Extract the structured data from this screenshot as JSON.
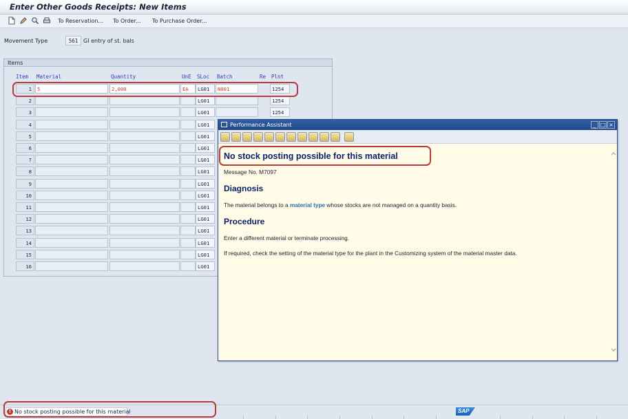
{
  "window": {
    "title": "Enter Other Goods Receipts: New Items"
  },
  "toolbar": {
    "icons": [
      "new-document-icon",
      "edit-pencil-icon",
      "find-icon",
      "print-icon"
    ],
    "buttons": [
      "To Reservation...",
      "To Order...",
      "To Purchase Order..."
    ]
  },
  "movement": {
    "label": "Movement Type",
    "code": "561",
    "text": "GI entry of st. bals"
  },
  "items": {
    "group_title": "Items",
    "headers": {
      "item": "Item",
      "material": "Material",
      "quantity": "Quantity",
      "une": "UnE",
      "sloc": "SLoc",
      "batch": "Batch",
      "re": "Re",
      "plnt": "Plnt"
    },
    "rows": [
      {
        "item": "1",
        "material": "5",
        "quantity": "2,000",
        "une": "EA",
        "sloc": "LG01",
        "batch": "N001",
        "plnt": "1254"
      },
      {
        "item": "2",
        "material": "",
        "quantity": "",
        "une": "",
        "sloc": "LG01",
        "batch": "",
        "plnt": "1254"
      },
      {
        "item": "3",
        "material": "",
        "quantity": "",
        "une": "",
        "sloc": "LG01",
        "batch": "",
        "plnt": "1254"
      },
      {
        "item": "4",
        "material": "",
        "quantity": "",
        "une": "",
        "sloc": "LG01",
        "batch": "",
        "plnt": ""
      },
      {
        "item": "5",
        "material": "",
        "quantity": "",
        "une": "",
        "sloc": "LG01",
        "batch": "",
        "plnt": ""
      },
      {
        "item": "6",
        "material": "",
        "quantity": "",
        "une": "",
        "sloc": "LG01",
        "batch": "",
        "plnt": ""
      },
      {
        "item": "7",
        "material": "",
        "quantity": "",
        "une": "",
        "sloc": "LG01",
        "batch": "",
        "plnt": ""
      },
      {
        "item": "8",
        "material": "",
        "quantity": "",
        "une": "",
        "sloc": "LG01",
        "batch": "",
        "plnt": ""
      },
      {
        "item": "9",
        "material": "",
        "quantity": "",
        "une": "",
        "sloc": "LG01",
        "batch": "",
        "plnt": ""
      },
      {
        "item": "10",
        "material": "",
        "quantity": "",
        "une": "",
        "sloc": "LG01",
        "batch": "",
        "plnt": ""
      },
      {
        "item": "11",
        "material": "",
        "quantity": "",
        "une": "",
        "sloc": "LG01",
        "batch": "",
        "plnt": ""
      },
      {
        "item": "12",
        "material": "",
        "quantity": "",
        "une": "",
        "sloc": "LG01",
        "batch": "",
        "plnt": ""
      },
      {
        "item": "13",
        "material": "",
        "quantity": "",
        "une": "",
        "sloc": "LG01",
        "batch": "",
        "plnt": ""
      },
      {
        "item": "14",
        "material": "",
        "quantity": "",
        "une": "",
        "sloc": "LG01",
        "batch": "",
        "plnt": ""
      },
      {
        "item": "15",
        "material": "",
        "quantity": "",
        "une": "",
        "sloc": "LG01",
        "batch": "",
        "plnt": ""
      },
      {
        "item": "16",
        "material": "",
        "quantity": "",
        "une": "",
        "sloc": "LG01",
        "batch": "",
        "plnt": ""
      }
    ]
  },
  "assistant": {
    "title": "Performance Assistant",
    "heading": "No stock posting possible for this material",
    "message_no": "Message No. M7097",
    "diagnosis_title": "Diagnosis",
    "diagnosis_pre": "The material belongs to a ",
    "diagnosis_link": "material type",
    "diagnosis_post": " whose stocks are not managed on a quantity basis.",
    "procedure_title": "Procedure",
    "procedure_1": "Enter a different material or terminate processing.",
    "procedure_2": "If required, check the setting of the material type for the plant in the Customizing system of the material master data."
  },
  "status": {
    "message": "No stock posting possible for this material",
    "type": "error"
  },
  "colors": {
    "highlight": "#b83a3a",
    "heading": "#0a1f6e",
    "link": "#2a6fb3",
    "field_red": "#c0392b"
  }
}
